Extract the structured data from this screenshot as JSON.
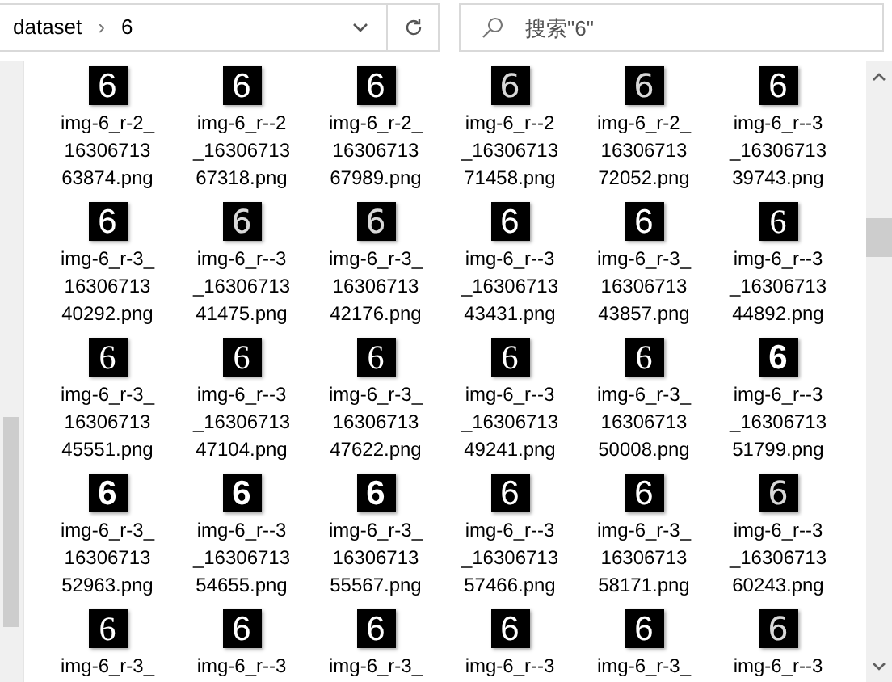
{
  "address_bar": {
    "path": [
      "dataset",
      "6"
    ],
    "separator": "›"
  },
  "search": {
    "placeholder": "搜索\"6\""
  },
  "files": [
    {
      "thumb_text": "6",
      "kind": "sans",
      "lines": [
        "img-6_r-2_",
        "16306713",
        "63874.png"
      ]
    },
    {
      "thumb_text": "6",
      "kind": "sans",
      "lines": [
        "img-6_r--2",
        "_16306713",
        "67318.png"
      ]
    },
    {
      "thumb_text": "6",
      "kind": "sans",
      "lines": [
        "img-6_r-2_",
        "16306713",
        "67989.png"
      ]
    },
    {
      "thumb_text": "6",
      "kind": "thin",
      "lines": [
        "img-6_r--2",
        "_16306713",
        "71458.png"
      ]
    },
    {
      "thumb_text": "6",
      "kind": "thin",
      "lines": [
        "img-6_r-2_",
        "16306713",
        "72052.png"
      ]
    },
    {
      "thumb_text": "6",
      "kind": "sans",
      "lines": [
        "img-6_r--3",
        "_16306713",
        "39743.png"
      ]
    },
    {
      "thumb_text": "6",
      "kind": "sans",
      "lines": [
        "img-6_r-3_",
        "16306713",
        "40292.png"
      ]
    },
    {
      "thumb_text": "6",
      "kind": "thin",
      "lines": [
        "img-6_r--3",
        "_16306713",
        "41475.png"
      ]
    },
    {
      "thumb_text": "6",
      "kind": "thin",
      "lines": [
        "img-6_r-3_",
        "16306713",
        "42176.png"
      ]
    },
    {
      "thumb_text": "6",
      "kind": "sans",
      "lines": [
        "img-6_r--3",
        "_16306713",
        "43431.png"
      ]
    },
    {
      "thumb_text": "6",
      "kind": "sans",
      "lines": [
        "img-6_r-3_",
        "16306713",
        "43857.png"
      ]
    },
    {
      "thumb_text": "6",
      "kind": "serif",
      "lines": [
        "img-6_r--3",
        "_16306713",
        "44892.png"
      ]
    },
    {
      "thumb_text": "6",
      "kind": "serif",
      "lines": [
        "img-6_r-3_",
        "16306713",
        "45551.png"
      ]
    },
    {
      "thumb_text": "6",
      "kind": "serif",
      "lines": [
        "img-6_r--3",
        "_16306713",
        "47104.png"
      ]
    },
    {
      "thumb_text": "6",
      "kind": "serif",
      "lines": [
        "img-6_r-3_",
        "16306713",
        "47622.png"
      ]
    },
    {
      "thumb_text": "6",
      "kind": "serif",
      "lines": [
        "img-6_r--3",
        "_16306713",
        "49241.png"
      ]
    },
    {
      "thumb_text": "6",
      "kind": "serif",
      "lines": [
        "img-6_r-3_",
        "16306713",
        "50008.png"
      ]
    },
    {
      "thumb_text": "6",
      "kind": "bold",
      "lines": [
        "img-6_r--3",
        "_16306713",
        "51799.png"
      ]
    },
    {
      "thumb_text": "6",
      "kind": "bold",
      "lines": [
        "img-6_r-3_",
        "16306713",
        "52963.png"
      ]
    },
    {
      "thumb_text": "6",
      "kind": "bold",
      "lines": [
        "img-6_r--3",
        "_16306713",
        "54655.png"
      ]
    },
    {
      "thumb_text": "6",
      "kind": "bold",
      "lines": [
        "img-6_r-3_",
        "16306713",
        "55567.png"
      ]
    },
    {
      "thumb_text": "6",
      "kind": "sans",
      "lines": [
        "img-6_r--3",
        "_16306713",
        "57466.png"
      ]
    },
    {
      "thumb_text": "6",
      "kind": "sans",
      "lines": [
        "img-6_r-3_",
        "16306713",
        "58171.png"
      ]
    },
    {
      "thumb_text": "6",
      "kind": "thin",
      "lines": [
        "img-6_r--3",
        "_16306713",
        "60243.png"
      ]
    },
    {
      "thumb_text": "6",
      "kind": "serif",
      "lines": [
        "img-6_r-3_"
      ]
    },
    {
      "thumb_text": "6",
      "kind": "sans",
      "lines": [
        "img-6_r--3"
      ]
    },
    {
      "thumb_text": "6",
      "kind": "sans",
      "lines": [
        "img-6_r-3_"
      ]
    },
    {
      "thumb_text": "6",
      "kind": "sans",
      "lines": [
        "img-6_r--3"
      ]
    },
    {
      "thumb_text": "6",
      "kind": "sans",
      "lines": [
        "img-6_r-3_"
      ]
    },
    {
      "thumb_text": "6",
      "kind": "thin",
      "lines": [
        "img-6_r--3"
      ]
    }
  ]
}
